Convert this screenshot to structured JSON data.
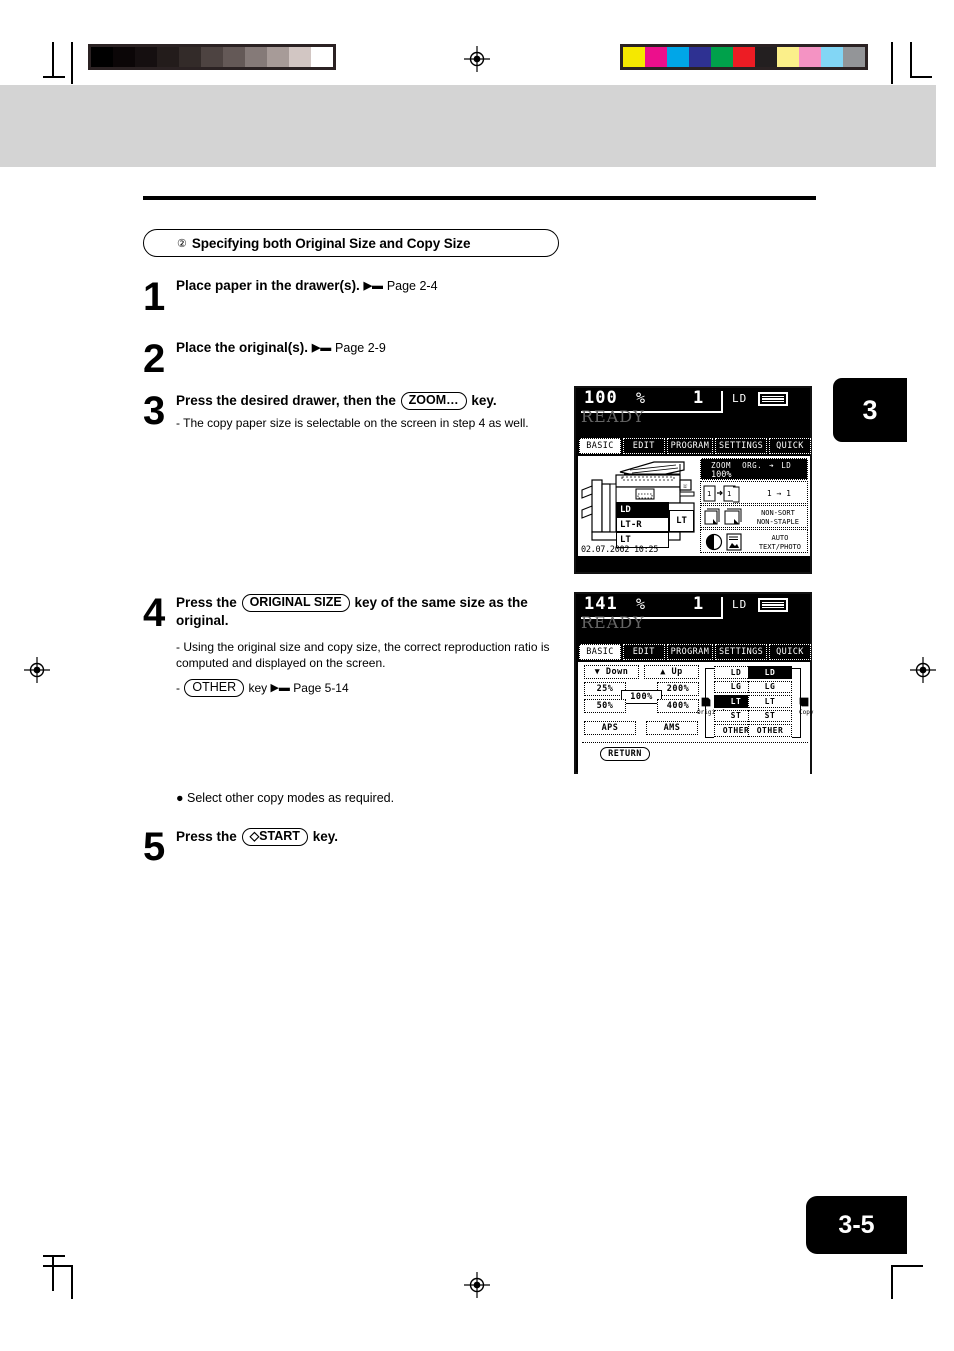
{
  "document": {
    "chapter_tab": "3",
    "page_number": "3-5"
  },
  "section": {
    "number_glyph": "②",
    "title": "Specifying both Original Size and Copy Size"
  },
  "steps": [
    {
      "num": "1",
      "title": "Place paper in the drawer(s).",
      "ref": "Page 2-4"
    },
    {
      "num": "2",
      "title": "Place the original(s).",
      "ref": "Page 2-9"
    },
    {
      "num": "3",
      "title_pre": "Press the desired drawer, then the",
      "key": "ZOOM…",
      "title_post": "key.",
      "note": "- The copy paper size is selectable on the screen in step 4 as well."
    },
    {
      "num": "4",
      "title_pre": "Press the",
      "key": "ORIGINAL SIZE",
      "title_post": "key of the same size as the original.",
      "note1": "- Using the original size and copy size, the correct reproduction ratio is computed and displayed on the screen.",
      "note2_dash": "-",
      "note2_key": "OTHER",
      "note2_mid": "key",
      "note2_ref": "Page 5-14"
    },
    {
      "num": "5",
      "title_pre": "Press the",
      "key": "◇START",
      "title_post": "key."
    }
  ],
  "bullet_note": "● Select other copy modes as required.",
  "lcd1": {
    "ratio_value": "100",
    "ratio_unit": "%",
    "copies": "1",
    "paper_label": "LD",
    "status": "READY",
    "tabs": [
      {
        "label": "BASIC",
        "selected": true
      },
      {
        "label": "EDIT",
        "selected": false
      },
      {
        "label": "PROGRAM",
        "selected": false
      },
      {
        "label": "SETTINGS",
        "selected": false
      },
      {
        "label": "QUICK",
        "selected": false
      }
    ],
    "drawers": [
      {
        "label": "LD",
        "selected": true
      },
      {
        "label": "LT-R",
        "selected": false
      },
      {
        "label": "LT",
        "selected": false
      }
    ],
    "bypass_label": "LT",
    "datetime": "02.07.2002 10:25",
    "info": {
      "zoom_label": "ZOOM",
      "zoom_org": "ORG.",
      "zoom_arrow": "➔",
      "zoom_dest": "LD",
      "zoom_value": "100%",
      "duplex": "1 → 1",
      "finish_line1": "NON-SORT",
      "finish_line2": "NON-STAPLE",
      "exposure_line1": "AUTO",
      "exposure_line2": "TEXT/PHOTO"
    }
  },
  "lcd2": {
    "ratio_value": "141",
    "ratio_unit": "%",
    "copies": "1",
    "paper_label": "LD",
    "status": "READY",
    "tabs": [
      {
        "label": "BASIC",
        "selected": true
      },
      {
        "label": "EDIT",
        "selected": false
      },
      {
        "label": "PROGRAM",
        "selected": false
      },
      {
        "label": "SETTINGS",
        "selected": false
      },
      {
        "label": "QUICK",
        "selected": false
      }
    ],
    "down_button": "▼ Down",
    "up_button": "▲ Up",
    "preset_25": "25%",
    "preset_50": "50%",
    "preset_100": "100%",
    "preset_200": "200%",
    "preset_400": "400%",
    "aps_button": "APS",
    "ams_button": "AMS",
    "return_button": "RETURN",
    "original_label": "Original",
    "copy_label": "Copy",
    "original_sizes": [
      {
        "label": "LD",
        "selected": false
      },
      {
        "label": "LG",
        "selected": false
      },
      {
        "label": "LT",
        "selected": true
      },
      {
        "label": "ST",
        "selected": false
      },
      {
        "label": "OTHER",
        "selected": false
      }
    ],
    "copy_sizes": [
      {
        "label": "LD",
        "selected": true
      },
      {
        "label": "LG",
        "selected": false
      },
      {
        "label": "LT",
        "selected": false
      },
      {
        "label": "ST",
        "selected": false
      },
      {
        "label": "OTHER",
        "selected": false
      }
    ]
  },
  "calibration": {
    "grayscale_patches": [
      "#000000",
      "#0b0607",
      "#150f10",
      "#231c1b",
      "#332b29",
      "#4d4341",
      "#645957",
      "#857a78",
      "#a79b98",
      "#d2c6c3",
      "#ffffff"
    ],
    "color_patches": [
      "#f5e800",
      "#ec0f8c",
      "#00a6e8",
      "#2e3192",
      "#00a14b",
      "#ed1c24",
      "#231f20",
      "#fbef8a",
      "#f493c3",
      "#82d6f5",
      "#939598"
    ]
  }
}
